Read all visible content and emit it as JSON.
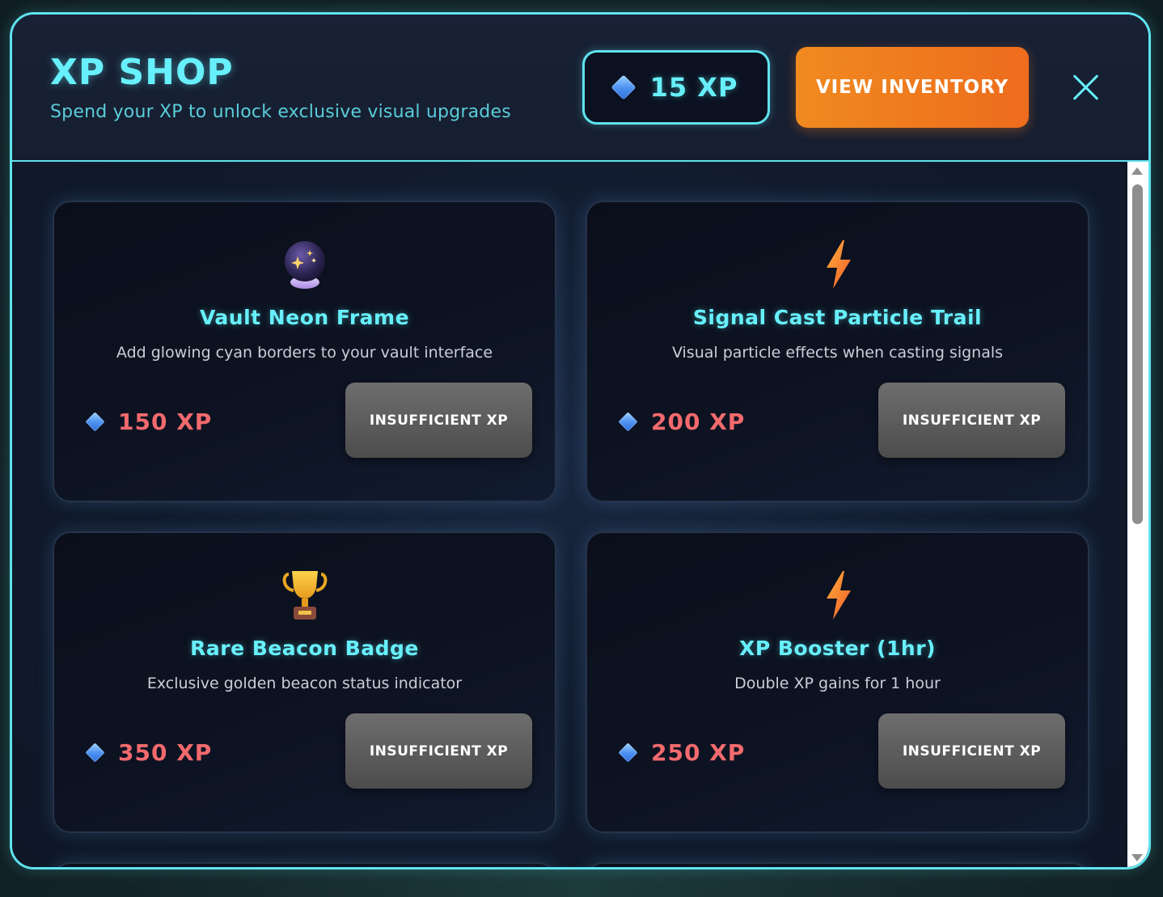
{
  "header": {
    "title": "XP SHOP",
    "subtitle": "Spend your XP to unlock exclusive visual upgrades",
    "balance": "15 XP",
    "inventory_label": "VIEW INVENTORY"
  },
  "items": [
    {
      "icon": "crystal-ball-icon",
      "name": "Vault Neon Frame",
      "description": "Add glowing cyan borders to your vault interface",
      "price": "150 XP",
      "button_label": "INSUFFICIENT XP"
    },
    {
      "icon": "lightning-bolt-icon",
      "name": "Signal Cast Particle Trail",
      "description": "Visual particle effects when casting signals",
      "price": "200 XP",
      "button_label": "INSUFFICIENT XP"
    },
    {
      "icon": "trophy-icon",
      "name": "Rare Beacon Badge",
      "description": "Exclusive golden beacon status indicator",
      "price": "350 XP",
      "button_label": "INSUFFICIENT XP"
    },
    {
      "icon": "lightning-bolt-icon",
      "name": "XP Booster (1hr)",
      "description": "Double XP gains for 1 hour",
      "price": "250 XP",
      "button_label": "INSUFFICIENT XP"
    }
  ],
  "colors": {
    "accent": "#67f0fb",
    "inventory_button": "#f08a1f",
    "price_insufficient": "#f26a6d",
    "disabled_button": "#5a5a5a"
  }
}
